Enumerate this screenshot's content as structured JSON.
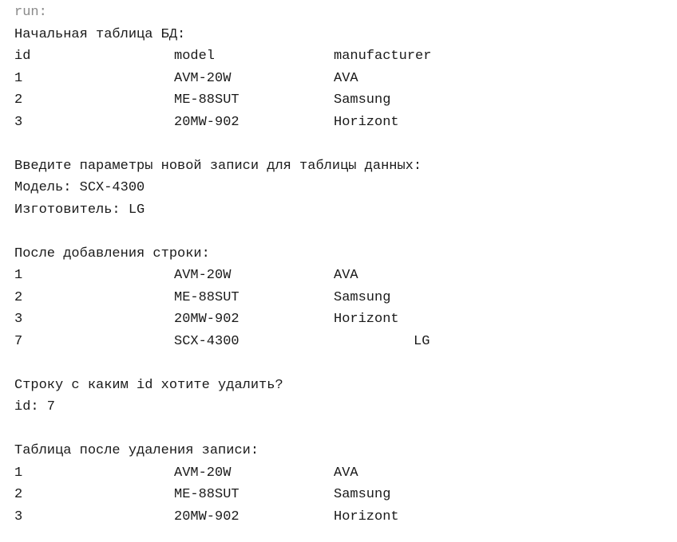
{
  "run_label": "run:",
  "initial": {
    "heading": "Начальная таблица БД:",
    "headers": [
      "id",
      "model",
      "manufacturer"
    ],
    "rows": [
      [
        "1",
        "AVM-20W",
        "AVA"
      ],
      [
        "2",
        "ME-88SUT",
        "Samsung"
      ],
      [
        "3",
        "20MW-902",
        "Horizont"
      ]
    ]
  },
  "input": {
    "prompt": "Введите параметры новой записи для таблицы данных:",
    "model_line": "Модель: SCX-4300",
    "manufacturer_line": "Изготовитель: LG"
  },
  "after_add": {
    "heading": "После добавления строки:",
    "rows": [
      [
        "1",
        "AVM-20W",
        "AVA"
      ],
      [
        "2",
        "ME-88SUT",
        "Samsung"
      ],
      [
        "3",
        "20MW-902",
        "Horizont"
      ],
      [
        "7",
        "SCX-4300",
        "LG"
      ]
    ]
  },
  "delete": {
    "question": "Строку с каким id хотите удалить?",
    "answer_line": "id: 7"
  },
  "after_delete": {
    "heading": "Таблица после удаления записи:",
    "rows": [
      [
        "1",
        "AVM-20W",
        "AVA"
      ],
      [
        "2",
        "ME-88SUT",
        "Samsung"
      ],
      [
        "3",
        "20MW-902",
        "Horizont"
      ]
    ]
  }
}
